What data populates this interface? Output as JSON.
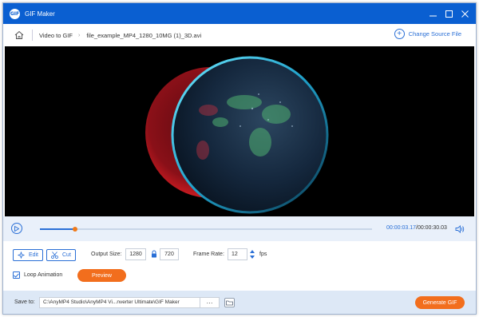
{
  "window": {
    "title": "GIF Maker",
    "logo_text": "GIF"
  },
  "nav": {
    "breadcrumb_root": "Video to GIF",
    "breadcrumb_file": "file_example_MP4_1280_10MG (1)_3D.avi",
    "change_source_label": "Change Source File"
  },
  "player": {
    "current_time": "00:00:03.17",
    "separator": "/",
    "total_time": "00:00:30.03",
    "progress": 0.106
  },
  "edit": {
    "edit_label": "Edit",
    "cut_label": "Cut",
    "output_size_label": "Output Size:",
    "width": "1280",
    "height": "720",
    "frame_rate_label": "Frame Rate:",
    "frame_rate": "12",
    "fps_label": "fps",
    "loop_label": "Loop Animation",
    "loop_checked": true,
    "preview_label": "Preview"
  },
  "footer": {
    "save_to_label": "Save to:",
    "path": "C:\\AnyMP4 Studio\\AnyMP4 Vi...nverter Ultimate\\GIF Maker",
    "browse_label": "···",
    "generate_label": "Generate GIF"
  },
  "colors": {
    "accent": "#2a6fd6",
    "titlebar": "#0a5fd1",
    "orange": "#f26e1d"
  },
  "icons": [
    "home-icon",
    "plus-icon",
    "minimize-icon",
    "maximize-icon",
    "close-icon",
    "play-icon",
    "volume-icon",
    "edit-icon",
    "scissors-icon",
    "lock-icon",
    "spinner-arrows-icon",
    "check-icon",
    "folder-icon"
  ]
}
